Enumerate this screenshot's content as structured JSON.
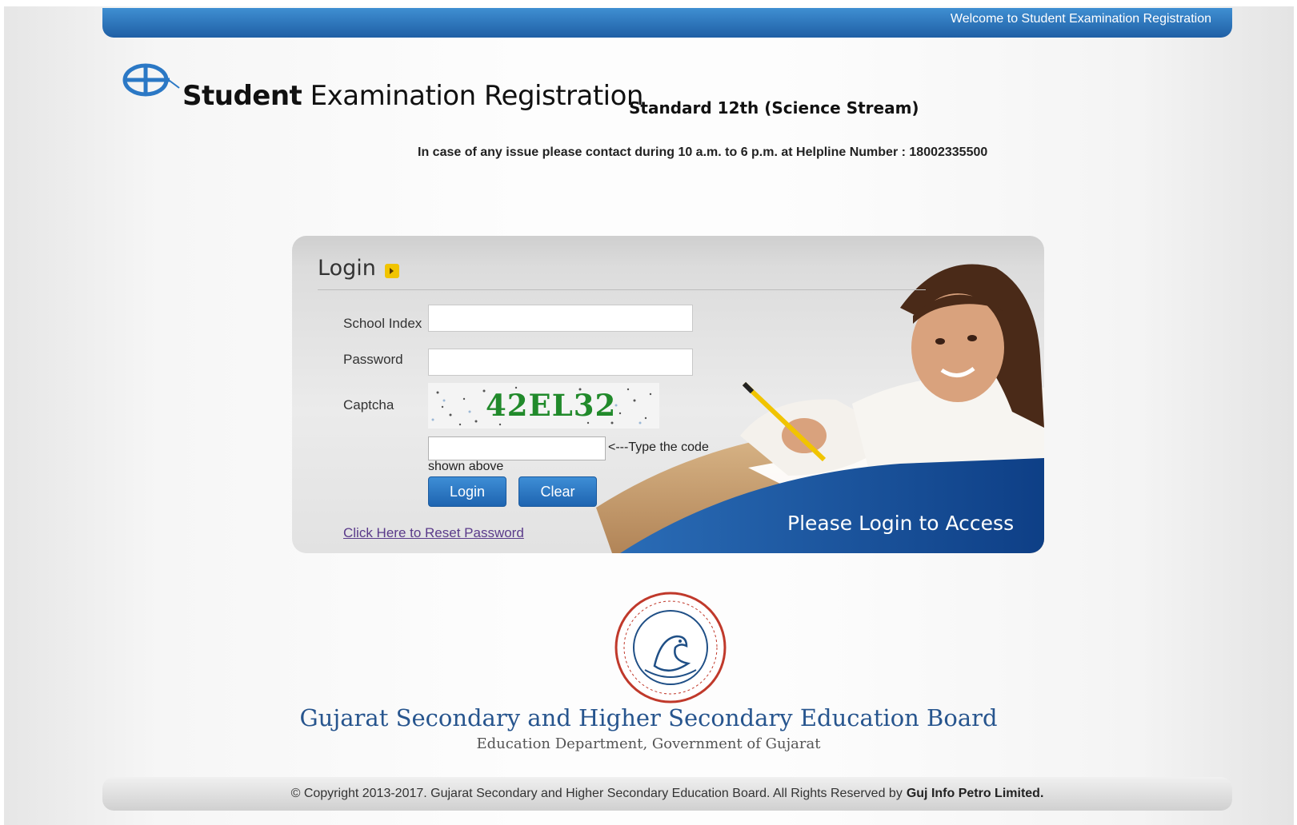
{
  "header": {
    "welcome": "Welcome to Student Examination Registration"
  },
  "branding": {
    "title_bold": "Student",
    "title_rest": "Examination Registration",
    "subtitle": "Standard 12th (Science Stream)",
    "helpline": "In case of any issue please contact during 10 a.m. to 6 p.m. at Helpline Number : 18002335500"
  },
  "login": {
    "heading": "Login",
    "school_index_label": "School Index",
    "school_index_value": "",
    "password_label": "Password",
    "password_value": "",
    "captcha_label": "Captcha",
    "captcha_code": "42EL32",
    "captcha_input_value": "",
    "captcha_hint_line1": "<---Type the code",
    "captcha_hint_line2": "shown above",
    "login_button": "Login",
    "clear_button": "Clear",
    "reset_link": "Click Here to Reset Password",
    "banner_text": "Please Login to Access"
  },
  "board": {
    "name": "Gujarat Secondary and Higher Secondary Education Board",
    "department": "Education Department, Government of Gujarat"
  },
  "footer": {
    "copyright": "© Copyright 2013-2017. Gujarat Secondary and Higher Secondary Education Board. All Rights Reserved by",
    "company": "Guj Info Petro Limited."
  },
  "colors": {
    "accent_blue": "#1f5fa5",
    "captcha_green": "#218a2b",
    "board_blue": "#27558e"
  }
}
